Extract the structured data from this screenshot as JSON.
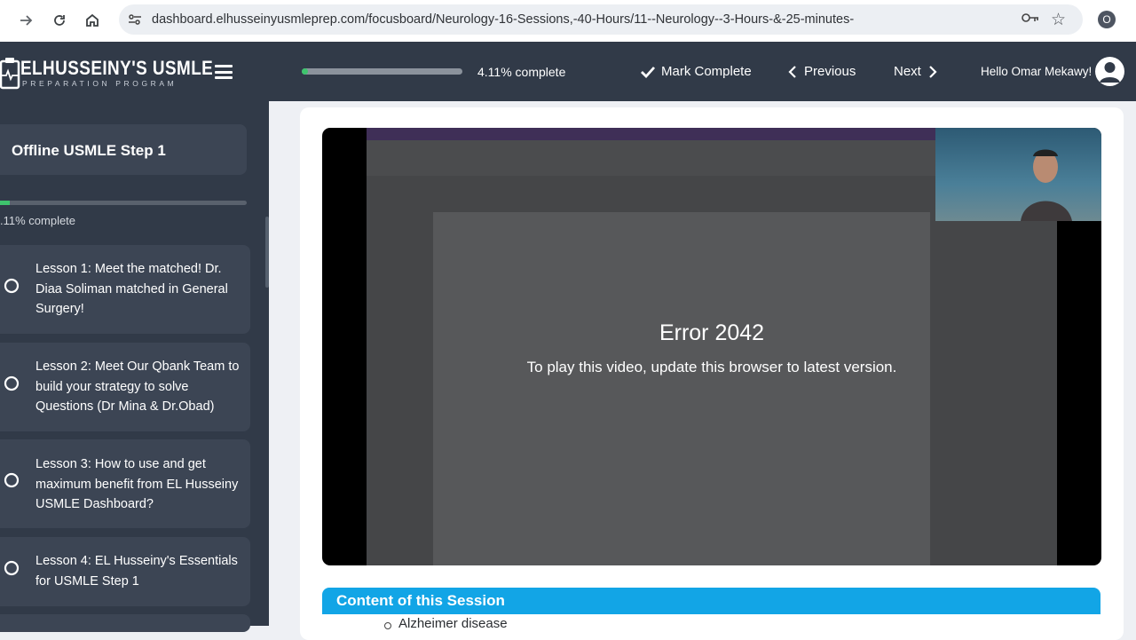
{
  "browser": {
    "url": "dashboard.elhusseinyusmleprep.com/focusboard/Neurology-16-Sessions,-40-Hours/11--Neurology--3-Hours-&-25-minutes-",
    "profile_initial": "O"
  },
  "header": {
    "logo_title": "ELHUSSEINY'S USMLE",
    "logo_subtitle": "PREPARATION PROGRAM",
    "progress_percent": 4.11,
    "progress_text": "4.11% complete",
    "mark_complete": "Mark Complete",
    "previous": "Previous",
    "next": "Next",
    "greeting": "Hello Omar Mekawy!"
  },
  "sidebar": {
    "course_title": "Offline USMLE Step 1",
    "progress_percent": 4.11,
    "progress_text": ".11% complete",
    "lessons": [
      {
        "label": "Lesson 1: Meet the matched! Dr. Diaa Soliman matched in General Surgery!"
      },
      {
        "label": "Lesson 2: Meet Our Qbank Team to build your strategy to solve Questions (Dr Mina & Dr.Obad)"
      },
      {
        "label": "Lesson 3: How to use and get maximum benefit from EL Husseiny USMLE Dashboard?"
      },
      {
        "label": "Lesson 4: EL Husseiny's Essentials for USMLE Step 1"
      }
    ]
  },
  "video": {
    "error_title": "Error 2042",
    "error_message": "To play this video, update this browser to latest version."
  },
  "session": {
    "title": "Content of this Session",
    "items": [
      "Alzheimer disease"
    ]
  },
  "colors": {
    "header_bg": "#313a48",
    "progress_green": "#3ec46d",
    "session_blue": "#12a5e6"
  }
}
